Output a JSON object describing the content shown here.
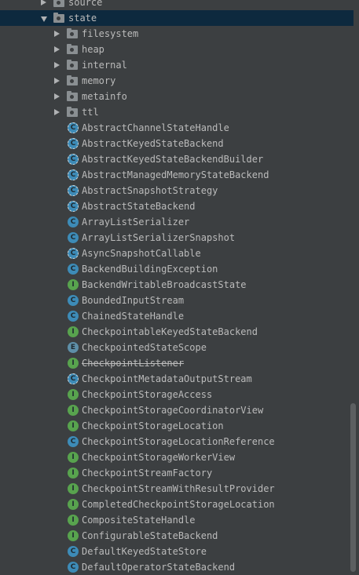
{
  "tree": {
    "items": [
      {
        "label": "source",
        "type": "package",
        "depth": 0,
        "state": "collapsed"
      },
      {
        "label": "state",
        "type": "package",
        "depth": 0,
        "state": "expanded",
        "selected": true
      },
      {
        "label": "filesystem",
        "type": "package",
        "depth": 1,
        "state": "collapsed"
      },
      {
        "label": "heap",
        "type": "package",
        "depth": 1,
        "state": "collapsed"
      },
      {
        "label": "internal",
        "type": "package",
        "depth": 1,
        "state": "collapsed"
      },
      {
        "label": "memory",
        "type": "package",
        "depth": 1,
        "state": "collapsed"
      },
      {
        "label": "metainfo",
        "type": "package",
        "depth": 1,
        "state": "collapsed"
      },
      {
        "label": "ttl",
        "type": "package",
        "depth": 1,
        "state": "collapsed"
      },
      {
        "label": "AbstractChannelStateHandle",
        "type": "abstract",
        "depth": 1
      },
      {
        "label": "AbstractKeyedStateBackend",
        "type": "abstract",
        "depth": 1
      },
      {
        "label": "AbstractKeyedStateBackendBuilder",
        "type": "abstract",
        "depth": 1
      },
      {
        "label": "AbstractManagedMemoryStateBackend",
        "type": "abstract",
        "depth": 1
      },
      {
        "label": "AbstractSnapshotStrategy",
        "type": "abstract",
        "depth": 1
      },
      {
        "label": "AbstractStateBackend",
        "type": "abstract",
        "depth": 1
      },
      {
        "label": "ArrayListSerializer",
        "type": "class",
        "depth": 1
      },
      {
        "label": "ArrayListSerializerSnapshot",
        "type": "class",
        "depth": 1
      },
      {
        "label": "AsyncSnapshotCallable",
        "type": "abstract",
        "depth": 1
      },
      {
        "label": "BackendBuildingException",
        "type": "class",
        "depth": 1
      },
      {
        "label": "BackendWritableBroadcastState",
        "type": "interface",
        "depth": 1
      },
      {
        "label": "BoundedInputStream",
        "type": "class",
        "depth": 1
      },
      {
        "label": "ChainedStateHandle",
        "type": "class",
        "depth": 1
      },
      {
        "label": "CheckpointableKeyedStateBackend",
        "type": "interface",
        "depth": 1
      },
      {
        "label": "CheckpointedStateScope",
        "type": "enum",
        "depth": 1
      },
      {
        "label": "CheckpointListener",
        "type": "interface",
        "depth": 1,
        "deprecated": true
      },
      {
        "label": "CheckpointMetadataOutputStream",
        "type": "abstract",
        "depth": 1
      },
      {
        "label": "CheckpointStorageAccess",
        "type": "interface",
        "depth": 1
      },
      {
        "label": "CheckpointStorageCoordinatorView",
        "type": "interface",
        "depth": 1
      },
      {
        "label": "CheckpointStorageLocation",
        "type": "interface",
        "depth": 1
      },
      {
        "label": "CheckpointStorageLocationReference",
        "type": "class",
        "depth": 1
      },
      {
        "label": "CheckpointStorageWorkerView",
        "type": "interface",
        "depth": 1
      },
      {
        "label": "CheckpointStreamFactory",
        "type": "interface",
        "depth": 1
      },
      {
        "label": "CheckpointStreamWithResultProvider",
        "type": "interface",
        "depth": 1
      },
      {
        "label": "CompletedCheckpointStorageLocation",
        "type": "interface",
        "depth": 1
      },
      {
        "label": "CompositeStateHandle",
        "type": "interface",
        "depth": 1
      },
      {
        "label": "ConfigurableStateBackend",
        "type": "interface",
        "depth": 1
      },
      {
        "label": "DefaultKeyedStateStore",
        "type": "class",
        "depth": 1
      },
      {
        "label": "DefaultOperatorStateBackend",
        "type": "class",
        "depth": 1
      }
    ]
  },
  "icons": {
    "class": "C",
    "abstract": "C",
    "interface": "I",
    "enum": "E"
  },
  "colors": {
    "background": "#3c3f41",
    "selected_row": "#0d293e",
    "text": "#bbbbbb"
  }
}
